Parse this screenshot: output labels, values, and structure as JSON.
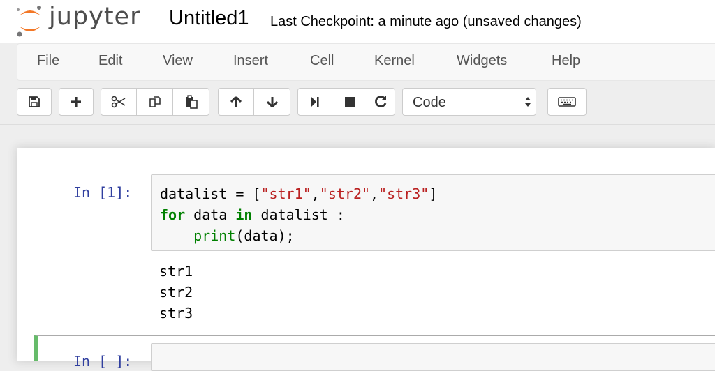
{
  "header": {
    "logo_text": "jupyter",
    "notebook_title": "Untitled1",
    "checkpoint_status": "Last Checkpoint: a minute ago (unsaved changes)"
  },
  "menu": {
    "items": [
      "File",
      "Edit",
      "View",
      "Insert",
      "Cell",
      "Kernel",
      "Widgets",
      "Help"
    ]
  },
  "toolbar": {
    "buttons": [
      "save-icon",
      "plus-icon",
      "scissors-icon",
      "copy-icon",
      "paste-icon",
      "arrow-up-icon",
      "arrow-down-icon",
      "step-forward-icon",
      "stop-icon",
      "restart-icon",
      "keyboard-icon"
    ],
    "cell_type": "Code"
  },
  "cells": [
    {
      "prompt": "In [1]:",
      "code_line1": {
        "var": "datalist",
        "eq": " = [",
        "s1": "\"str1\"",
        "s2": "\"str2\"",
        "s3": "\"str3\"",
        "end": "]"
      },
      "code_line2": {
        "kw_for": "for",
        "mid": " data ",
        "kw_in": "in",
        "rest": " datalist :"
      },
      "code_line3": {
        "indent": "    ",
        "fn": "print",
        "args": "(data);"
      },
      "output": [
        "str1",
        "str2",
        "str3"
      ]
    },
    {
      "prompt": "In [ ]:"
    }
  ],
  "colors": {
    "prompt": "#303F9F",
    "keyword": "#008000",
    "string": "#BA2121",
    "active_cell_border": "#66BB6A",
    "logo_orange": "#F37726"
  }
}
